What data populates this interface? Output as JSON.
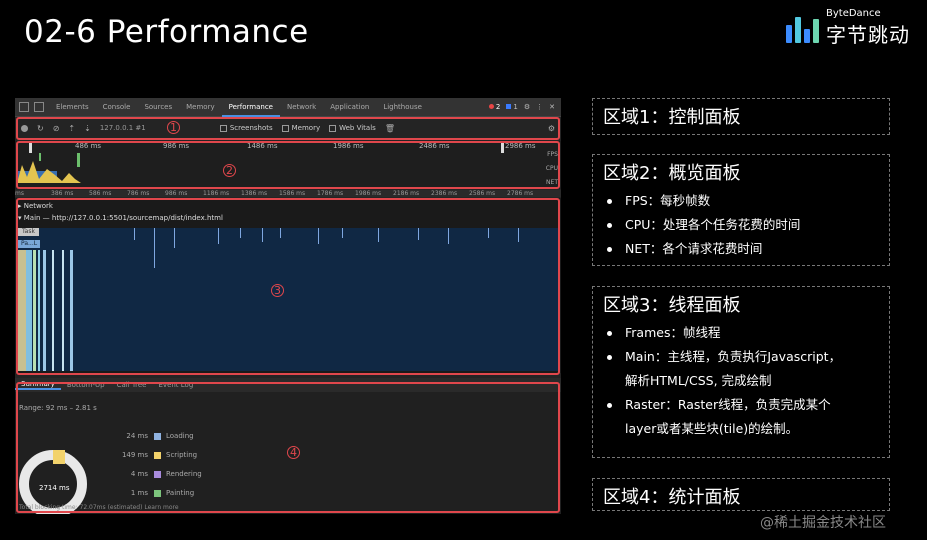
{
  "slide": {
    "title": "02-6 Performance"
  },
  "logo": {
    "en": "ByteDance",
    "zh": "字节跳动"
  },
  "devtools": {
    "tabs": [
      "Elements",
      "Console",
      "Sources",
      "Memory",
      "Performance",
      "Network",
      "Application",
      "Lighthouse"
    ],
    "active_tab": "Performance",
    "error_count": "2",
    "info_count": "1",
    "toolbar": {
      "url": "127.0.0.1 #1",
      "screenshots": "Screenshots",
      "memory": "Memory",
      "web_vitals": "Web Vitals"
    },
    "overview": {
      "ticks": [
        "486 ms",
        "986 ms",
        "1486 ms",
        "1986 ms",
        "2486 ms",
        "2986 ms"
      ],
      "labels": [
        "FPS",
        "CPU",
        "NET"
      ]
    },
    "ruler2": [
      "ms",
      "386 ms",
      "586 ms",
      "786 ms",
      "986 ms",
      "1186 ms",
      "1386 ms",
      "1586 ms",
      "1786 ms",
      "1986 ms",
      "2186 ms",
      "2386 ms",
      "2586 ms",
      "2786 ms"
    ],
    "threads": {
      "network": "Network",
      "main": "Main — http://127.0.0.1:5501/sourcemap/dist/index.html",
      "task": "Task",
      "pa": "Pa...L"
    },
    "summary": {
      "tabs": [
        "Summary",
        "Bottom-Up",
        "Call Tree",
        "Event Log"
      ],
      "active_tab": "Summary",
      "range": "Range: 92 ms – 2.81 s",
      "rows": [
        {
          "value": "24 ms",
          "label": "Loading",
          "color": "#8fb2e0"
        },
        {
          "value": "149 ms",
          "label": "Scripting",
          "color": "#f2d26b"
        },
        {
          "value": "4 ms",
          "label": "Rendering",
          "color": "#a88bdc"
        },
        {
          "value": "1 ms",
          "label": "Painting",
          "color": "#7cc47c"
        }
      ],
      "total": "2714 ms",
      "footer": "Total blocking time: 72.07ms (estimated)  Learn more"
    },
    "region_numbers": [
      "1",
      "2",
      "3",
      "4"
    ]
  },
  "panels": [
    {
      "title": "区域1：控制面板",
      "items": []
    },
    {
      "title": "区域2：概览面板",
      "items": [
        "FPS：每秒帧数",
        "CPU：处理各个任务花费的时间",
        "NET：各个请求花费时间"
      ]
    },
    {
      "title": "区域3：线程面板",
      "items": [
        "Frames：帧线程",
        "Main：主线程，负责执行Javascript，",
        "解析HTML/CSS, 完成绘制",
        "Raster：Raster线程，负责完成某个",
        "layer或者某些块(tile)的绘制。"
      ]
    },
    {
      "title": "区域4：统计面板",
      "items": []
    }
  ],
  "watermark": "@稀土掘金技术社区"
}
